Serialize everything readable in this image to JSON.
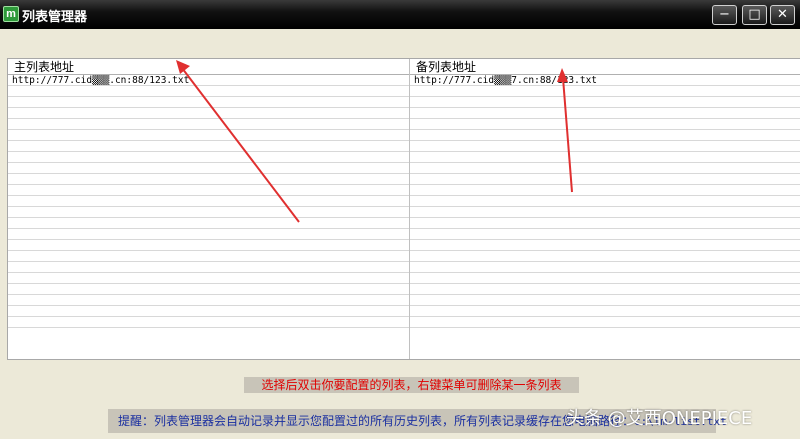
{
  "window": {
    "title": "列表管理器",
    "icon_letter": "m",
    "buttons": {
      "minimize": "−",
      "maximize": "□",
      "close": "✕"
    }
  },
  "table": {
    "columns": [
      "主列表地址",
      "备列表地址"
    ],
    "rows": [
      [
        "http://777.cid▒▒▒.cn:88/123.txt",
        "http://777.cid▒▒▒7.cn:88/123.txt"
      ]
    ]
  },
  "hints": {
    "red": "选择后双击你要配置的列表，右键菜单可删除某一条列表",
    "blue_text": "提醒：列表管理器会自动记录并显示您配置过的所有历史列表，所有列表记录缓存在您电脑路径：",
    "blue_path": "c:\\lm-list.txt"
  },
  "watermark": "头条 @艾西ONEPIECE",
  "colors": {
    "red_hint": "#e00000",
    "blue_hint": "#1a2fa0",
    "arrow": "#e03030",
    "app_icon_green": "#2e9a3a"
  }
}
